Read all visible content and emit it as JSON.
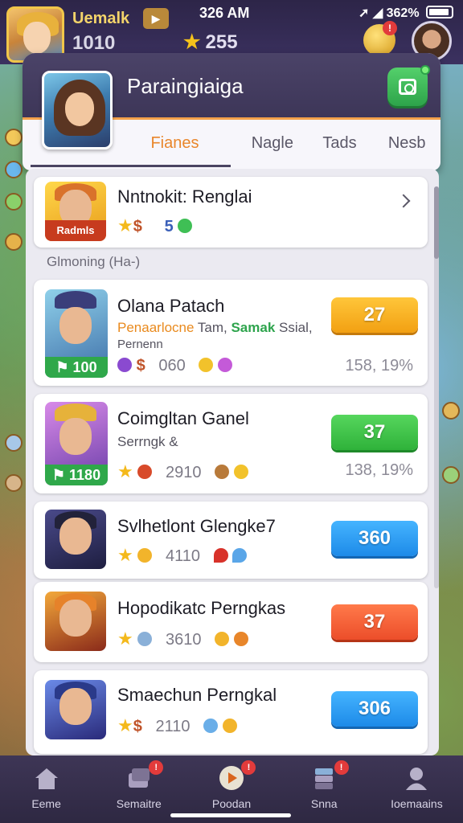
{
  "status_bar": {
    "time": "326 AM",
    "signal_text": "➚ ◢ 362%"
  },
  "player": {
    "name": "Uemalk",
    "level": "1010",
    "stars": "255",
    "play_chip": "▶",
    "notification_count": "!"
  },
  "panel": {
    "title": "Paraingiaiga",
    "tabs": [
      {
        "label": "Fianes",
        "active": true
      },
      {
        "label": "Nagle",
        "active": false
      },
      {
        "label": "Tads",
        "active": false
      },
      {
        "label": "Nesb",
        "active": false
      }
    ]
  },
  "featured": {
    "name": "Nntnokit: Renglai",
    "thumb_label": "Radmls",
    "stat_a": "$",
    "stat_b": "5"
  },
  "section": {
    "label": "Glmoning (Ha-)"
  },
  "items": [
    {
      "name": "Olana Patach",
      "sub_orange": "Penaarlocne",
      "sub_plain": "Tam,",
      "sub_green": "Samak",
      "sub_rest": "Ssial,",
      "sub_line2": "Pernenn",
      "thumb_value": "100",
      "stat_value": "060",
      "pill_value": "27",
      "pct": "158, 19%",
      "pill_color": "orange",
      "accent": "#f2a012"
    },
    {
      "name": "Coimgltan Ganel",
      "sub_plain": "Serrngk &",
      "thumb_value": "1180",
      "stat_value": "2910",
      "pill_value": "37",
      "pct": "138, 19%",
      "pill_color": "green",
      "accent": "#2fb23a"
    },
    {
      "name": "Svlhetlont Glengke7",
      "stat_value": "4110",
      "pill_value": "360",
      "pill_color": "blue",
      "accent": "#1d8ae8"
    },
    {
      "name": "Hopodikatc Perngkas",
      "stat_value": "3610",
      "pill_value": "37",
      "pill_color": "red",
      "accent": "#ec4e2a"
    },
    {
      "name": "Smaechun Perngkal",
      "stat_value": "2110",
      "pill_value": "306",
      "pill_color": "blue",
      "accent": "#1d8ae8"
    }
  ],
  "bottom_nav": [
    {
      "label": "Eeme",
      "icon": "home-icon",
      "badge": ""
    },
    {
      "label": "Semaitre",
      "icon": "cards-icon",
      "badge": "!"
    },
    {
      "label": "Poodan",
      "icon": "play-circle-icon",
      "badge": "!"
    },
    {
      "label": "Snna",
      "icon": "stack-icon",
      "badge": "!"
    },
    {
      "label": "Ioemaains",
      "icon": "profile-icon",
      "badge": ""
    }
  ],
  "colors": {
    "header_bg": "#3d3658",
    "active_tab": "#e9862b",
    "star": "#f4b91b"
  }
}
